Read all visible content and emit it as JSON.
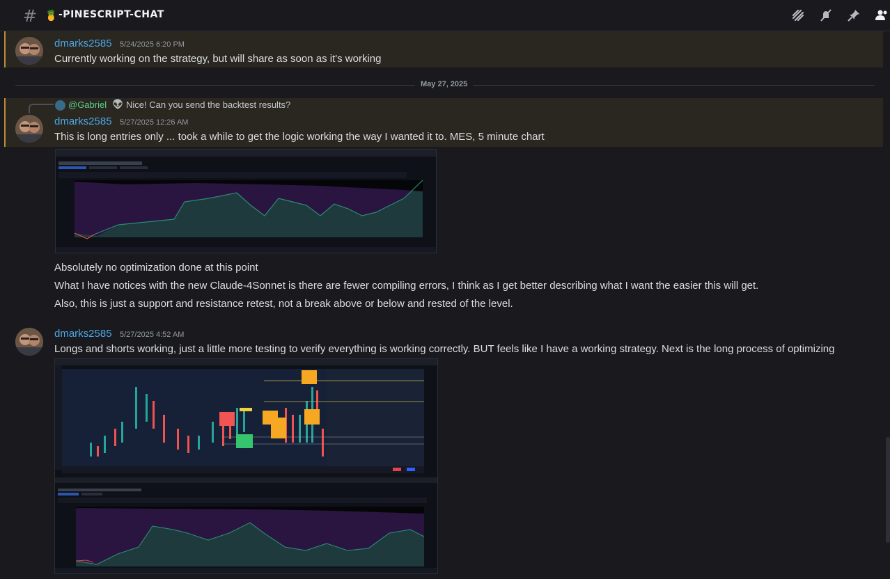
{
  "channel": {
    "emoji": "🍍",
    "name": "-PINESCRIPT-CHAT",
    "icons": [
      "threads-icon",
      "mute-icon",
      "pin-icon",
      "members-icon"
    ]
  },
  "messages": [
    {
      "author": "dmarks2585",
      "timestamp": "5/24/2025 6:20 PM",
      "lines": [
        "Currently working on the strategy, but will share as soon as it's working"
      ]
    },
    {
      "author": "dmarks2585",
      "timestamp": "5/27/2025 12:26 AM",
      "reply": {
        "mention": "@Gabriel",
        "emoji": "👽",
        "text": "Nice! Can you send the backtest results?"
      },
      "lines": [
        "This is long entries only ... took a while to get the logic working the way I wanted it to. MES, 5 minute chart",
        "Absolutely no optimization done at this point",
        "What  I have notices with the new Claude-4Sonnet is there are fewer compiling errors, I think as I get better describing what I want the easier this will get.",
        "Also, this is just a support and resistance retest, not a break above or below and rested of the level."
      ]
    },
    {
      "author": "dmarks2585",
      "timestamp": "5/27/2025 4:52 AM",
      "lines": [
        "Longs and shorts working, just a little more testing to verify everything is working correctly. BUT feels like I have a working strategy. Next is the long process of optimizing"
      ]
    }
  ],
  "date_divider": "May 27, 2025",
  "colors": {
    "background": "#1a1a1e",
    "highlight": "#2a2620",
    "highlight_border": "#c08a3a",
    "username": "#4aa8e8",
    "mention": "#5ad08a"
  }
}
